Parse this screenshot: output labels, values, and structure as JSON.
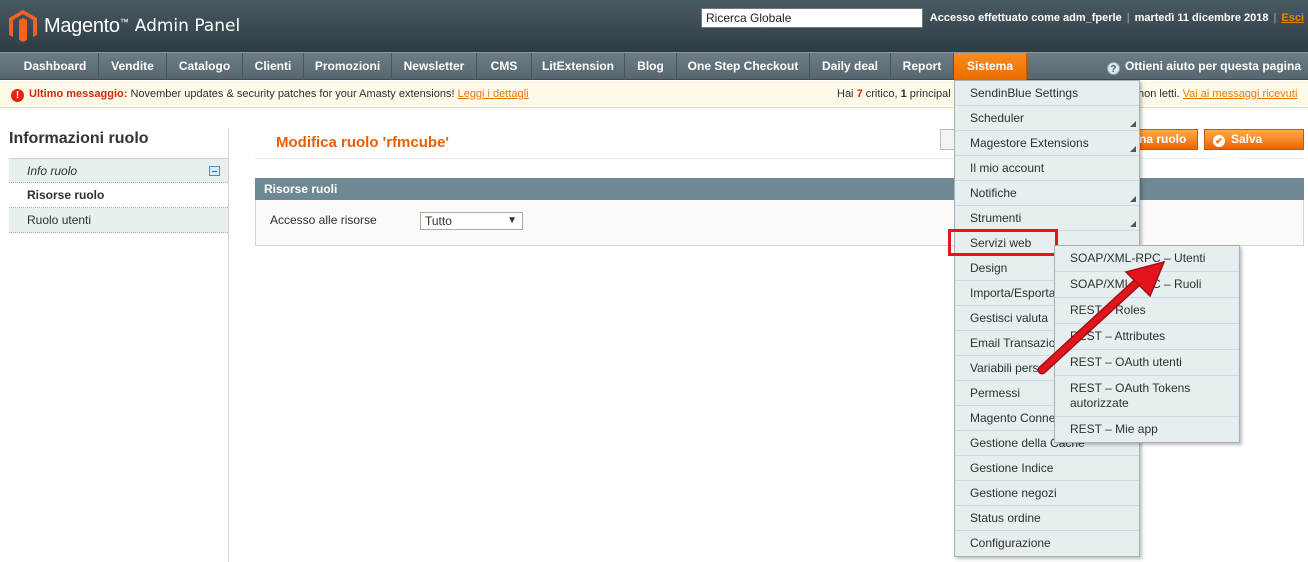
{
  "header": {
    "brand": "Magento",
    "brand_tm": "™",
    "subtitle": "Admin Panel",
    "search_value": "Ricerca Globale",
    "logged_in": "Accesso effettuato come adm_fperle",
    "date": "martedì 11 dicembre 2018",
    "logout": "Esci"
  },
  "nav": {
    "items": [
      "Dashboard",
      "Vendite",
      "Catalogo",
      "Clienti",
      "Promozioni",
      "Newsletter",
      "CMS",
      "LitExtension",
      "Blog",
      "One Step Checkout",
      "Daily deal",
      "Report",
      "Sistema"
    ],
    "help": "Ottieni aiuto per questa pagina"
  },
  "message": {
    "label": "Ultimo messaggio:",
    "text": "November updates & security patches for your Amasty extensions!",
    "link": "Leggi i dettagli",
    "right_prefix": "Hai ",
    "critical_count": "7",
    "critical_label": " critico, ",
    "major_count": "1",
    "major_label": " principal",
    "right_rest": "non letti.",
    "right_link": "Vai ai messaggi ricevuti"
  },
  "sidebar": {
    "title": "Informazioni ruolo",
    "tabs": [
      "Info ruolo",
      "Risorse ruolo",
      "Ruolo utenti"
    ]
  },
  "main": {
    "title": "Modifica ruolo 'rfmcube'",
    "delete_partial": "na ruolo",
    "save": "Salva ruolo",
    "fieldset_title": "Risorse ruoli",
    "field_label": "Accesso alle risorse",
    "field_value": "Tutto"
  },
  "system_menu": {
    "items": [
      {
        "label": "SendinBlue Settings",
        "sub": false
      },
      {
        "label": "Scheduler",
        "sub": true
      },
      {
        "label": "Magestore Extensions",
        "sub": true
      },
      {
        "label": "Il mio account",
        "sub": false
      },
      {
        "label": "Notifiche",
        "sub": true
      },
      {
        "label": "Strumenti",
        "sub": true
      },
      {
        "label": "Servizi web",
        "sub": true
      },
      {
        "label": "Design",
        "sub": false
      },
      {
        "label": "Importa/Esporta",
        "sub": false
      },
      {
        "label": "Gestisci valuta",
        "sub": false
      },
      {
        "label": "Email Transazio",
        "sub": false
      },
      {
        "label": "Variabili pers",
        "sub": false
      },
      {
        "label": "Permessi",
        "sub": false
      },
      {
        "label": "Magento Conne",
        "sub": false
      },
      {
        "label": "Gestione della Cache",
        "sub": false
      },
      {
        "label": "Gestione Indice",
        "sub": false
      },
      {
        "label": "Gestione negozi",
        "sub": false
      },
      {
        "label": "Status ordine",
        "sub": false
      },
      {
        "label": "Configurazione",
        "sub": false
      }
    ]
  },
  "webservices_submenu": {
    "items": [
      "SOAP/XML-RPC – Utenti",
      "SOAP/XML-RPC – Ruoli",
      "REST – Roles",
      "REST – Attributes",
      "REST – OAuth utenti",
      "REST – OAuth Tokens autorizzate",
      "REST – Mie app"
    ]
  },
  "colors": {
    "accent": "#eb5e00",
    "highlight": "#e3141c"
  }
}
